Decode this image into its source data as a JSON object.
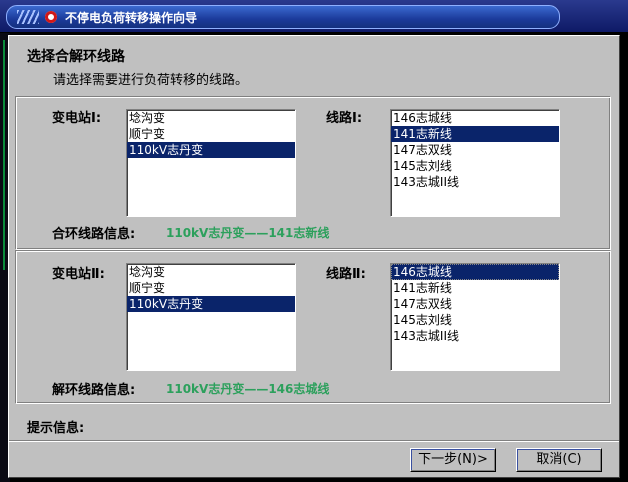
{
  "window": {
    "title": "不停电负荷转移操作向导"
  },
  "header": {
    "title": "选择合解环线路",
    "description": "请选择需要进行负荷转移的线路。"
  },
  "group1": {
    "substation_label": "变电站Ⅰ:",
    "substations": [
      "埝沟变",
      "顺宁变",
      "110kV志丹变"
    ],
    "selected_substation": "110kV志丹变",
    "line_label": "线路Ⅰ:",
    "lines": [
      "146志城线",
      "141志新线",
      "147志双线",
      "145志刘线",
      "143志城II线"
    ],
    "selected_line": "141志新线",
    "info_label": "合环线路信息:",
    "info_value": "110kV志丹变——141志新线"
  },
  "group2": {
    "substation_label": "变电站Ⅱ:",
    "substations": [
      "埝沟变",
      "顺宁变",
      "110kV志丹变"
    ],
    "selected_substation": "110kV志丹变",
    "line_label": "线路Ⅱ:",
    "lines": [
      "146志城线",
      "141志新线",
      "147志双线",
      "145志刘线",
      "143志城II线"
    ],
    "selected_line": "146志城线",
    "info_label": "解环线路信息:",
    "info_value": "110kV志丹变——146志城线"
  },
  "footer": {
    "hint_label": "提示信息:",
    "next_button": "下一步(N)>",
    "cancel_button": "取消(C)"
  },
  "colors": {
    "selection": "#0a246a",
    "info_text": "#2ca05c",
    "dialog_bg": "#c0c0c0"
  }
}
